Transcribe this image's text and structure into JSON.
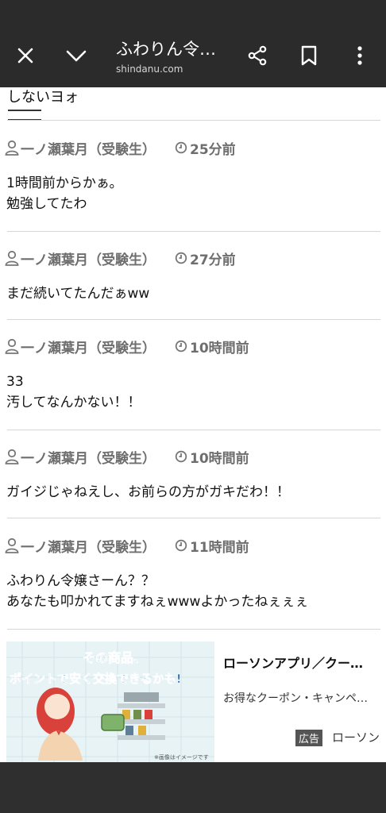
{
  "topbar": {
    "title": "ふわりん令…",
    "domain": "shindanu.com"
  },
  "fragment_text": "しないヨォ",
  "posts": [
    {
      "author": "一ノ瀬葉月（受験生）",
      "time": "25分前",
      "lines": [
        "1時間前からかぁ。",
        "勉強してたわ"
      ]
    },
    {
      "author": "一ノ瀬葉月（受験生）",
      "time": "27分前",
      "lines": [
        "まだ続いてたんだぁww",
        ""
      ]
    },
    {
      "author": "一ノ瀬葉月（受験生）",
      "time": "10時間前",
      "lines": [
        "33",
        "汚してなんかない！！"
      ]
    },
    {
      "author": "一ノ瀬葉月（受験生）",
      "time": "10時間前",
      "lines": [
        "ガイジじゃねえし、お前らの方がガキだわ！！",
        ""
      ]
    },
    {
      "author": "一ノ瀬葉月（受験生）",
      "time": "11時間前",
      "lines": [
        "ふわりん令嬢さーん？？",
        "あなたも叩かれてますねぇwwwよかったねぇぇぇ"
      ]
    }
  ],
  "ad": {
    "image_line1": "その商品、",
    "image_line2": "ポイントで安く交換できるかも!",
    "image_note": "※画像はイメージです",
    "title": "ローソンアプリ／クー…",
    "description": "お得なクーポン・キャンペ…",
    "label": "広告",
    "advertiser": "ローソン"
  }
}
